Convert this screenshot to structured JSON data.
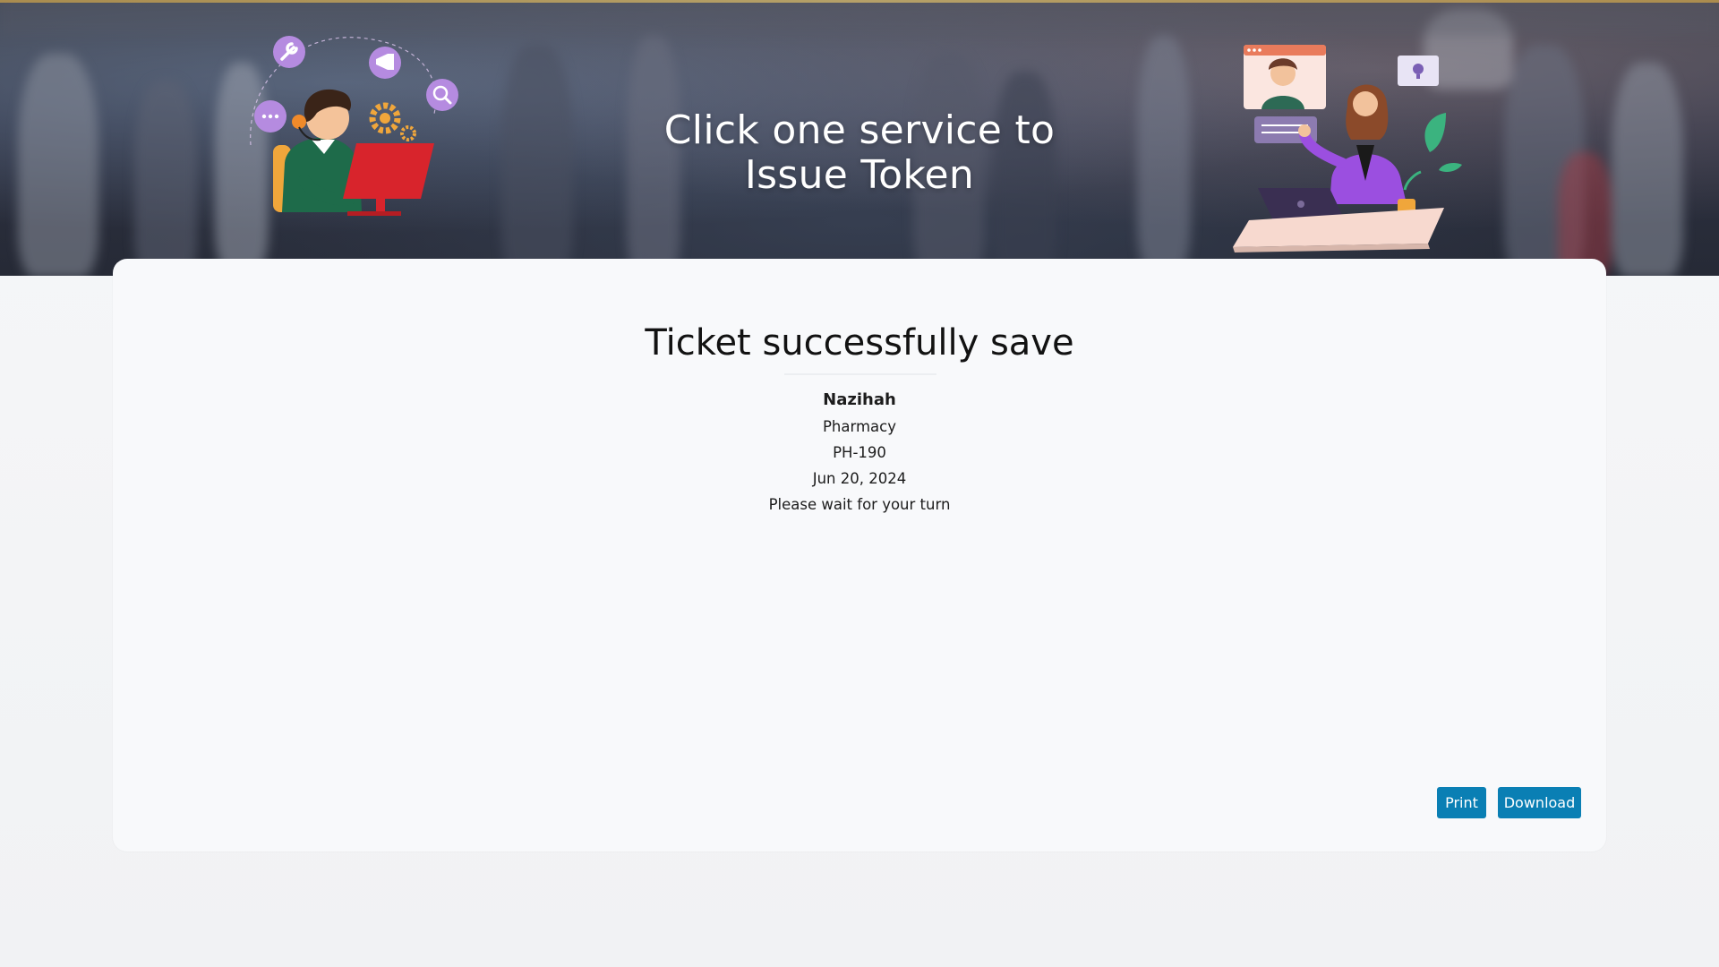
{
  "hero": {
    "title_line1": "Click one service to",
    "title_line2": "Issue Token"
  },
  "card": {
    "title": "Ticket successfully save"
  },
  "ticket": {
    "name": "Nazihah",
    "service": "Pharmacy",
    "token": "PH-190",
    "date": "Jun 20, 2024",
    "message": "Please wait for your turn"
  },
  "actions": {
    "print_label": "Print",
    "download_label": "Download"
  },
  "colors": {
    "button": "#0a7fb4",
    "card_bg": "#f8f9fb",
    "icon_purple": "#b58be0",
    "monitor_red": "#d8242c"
  },
  "icons": [
    "wrench-icon",
    "megaphone-icon",
    "search-icon",
    "chat-dots-icon",
    "gear-icon",
    "lightbulb-icon"
  ]
}
